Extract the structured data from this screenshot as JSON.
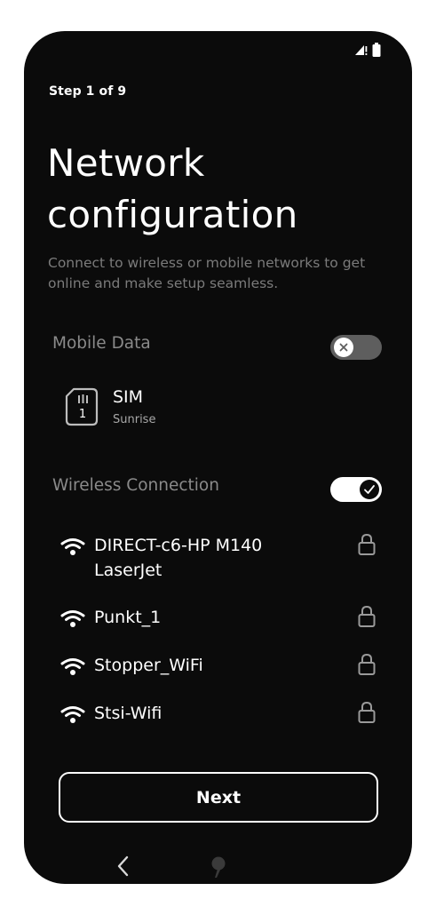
{
  "header": {
    "step": "Step 1 of 9",
    "title": "Network configuration",
    "subtitle": "Connect to wireless or mobile networks to get online and make setup seamless."
  },
  "mobile_data": {
    "label": "Mobile Data",
    "enabled": false,
    "sim": {
      "name": "SIM",
      "slot": "1",
      "provider": "Sunrise"
    }
  },
  "wireless": {
    "label": "Wireless Connection",
    "enabled": true,
    "networks": [
      {
        "name": "DIRECT-c6-HP M140 LaserJet",
        "icon": "wifi-icon",
        "secured": true
      },
      {
        "name": "Punkt_1",
        "icon": "wifi-icon",
        "secured": true
      },
      {
        "name": "Stopper_WiFi",
        "icon": "wifi-icon",
        "secured": true
      },
      {
        "name": "Stsi-Wifi",
        "icon": "wifi-icon",
        "secured": true
      }
    ]
  },
  "footer": {
    "next_label": "Next"
  },
  "colors": {
    "background": "#0b0b0b",
    "text": "#ffffff",
    "muted": "#7b7b7b",
    "toggle_off": "#5e5e5e"
  }
}
